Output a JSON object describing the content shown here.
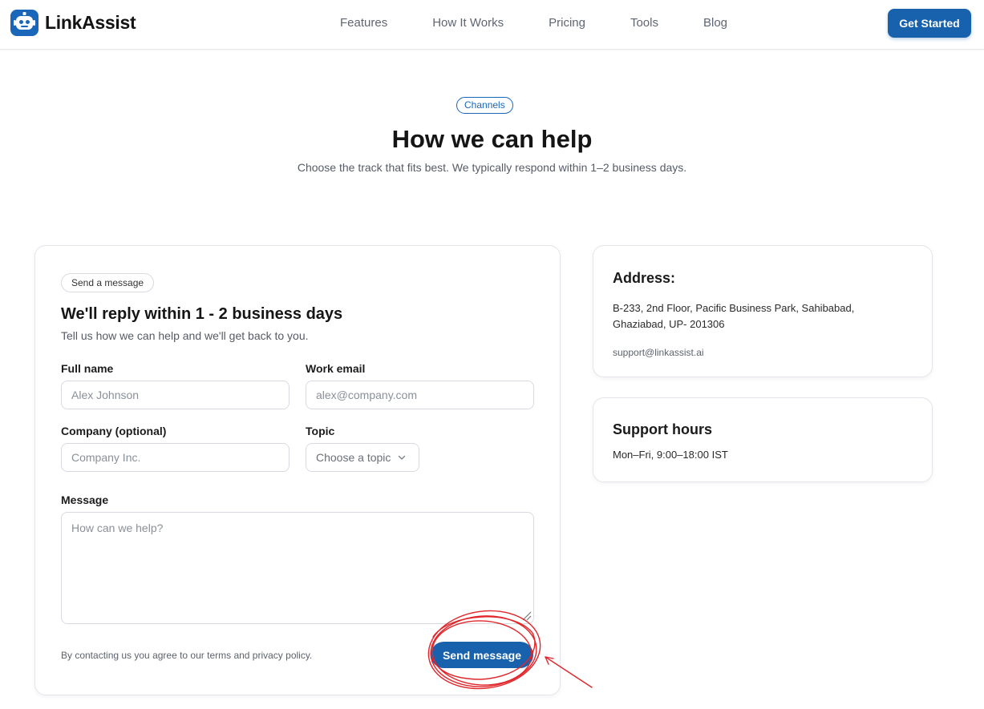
{
  "header": {
    "brand": "LinkAssist",
    "nav": [
      "Features",
      "How It Works",
      "Pricing",
      "Tools",
      "Blog"
    ],
    "cta": "Get Started",
    "brand_color": "#1a66b8"
  },
  "hero": {
    "pill": "Channels",
    "title": "How we can help",
    "subtitle": "Choose the track that fits best. We typically respond within 1–2 business days."
  },
  "form": {
    "tag": "Send a message",
    "title": "We'll reply within 1 - 2 business days",
    "subtitle": "Tell us how we can help and we'll get back to you.",
    "full_name": {
      "label": "Full name",
      "placeholder": "Alex Johnson",
      "value": ""
    },
    "work_email": {
      "label": "Work email",
      "placeholder": "alex@company.com",
      "value": ""
    },
    "company": {
      "label": "Company (optional)",
      "placeholder": "Company Inc.",
      "value": ""
    },
    "topic": {
      "label": "Topic",
      "selected": "Choose a topic"
    },
    "message": {
      "label": "Message",
      "placeholder": "How can we help?",
      "value": ""
    },
    "consent": "By contacting us you agree to our terms and privacy policy.",
    "submit": "Send message"
  },
  "address": {
    "title": "Address:",
    "line1": "B-233, 2nd Floor, Pacific Business Park, Sahibabad,",
    "line2": "Ghaziabad, UP- 201306",
    "email": "support@linkassist.ai"
  },
  "hours": {
    "title": "Support hours",
    "text": "Mon–Fri, 9:00–18:00 IST"
  },
  "colors": {
    "primary": "#1761ad",
    "annotation": "#e0262b"
  }
}
